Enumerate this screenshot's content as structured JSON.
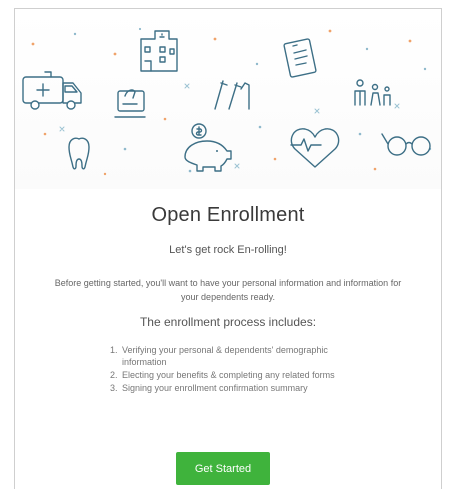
{
  "title": "Open Enrollment",
  "tagline": "Let's get rock En-rolling!",
  "intro": "Before getting started, you'll want to have your personal information and information for your dependents ready.",
  "process_heading": "The enrollment process includes:",
  "steps": [
    {
      "num": "1.",
      "text": "Verifying your personal & dependents' demographic information"
    },
    {
      "num": "2.",
      "text": "Electing your benefits & completing any related forms"
    },
    {
      "num": "3.",
      "text": "Signing your enrollment confirmation summary"
    }
  ],
  "cta_label": "Get Started",
  "colors": {
    "accent": "#3fb33c",
    "icon_stroke": "#3d6f86",
    "dots_orange": "#f0a36a",
    "dots_blue": "#8fb9cc"
  },
  "hero_icons": [
    "ambulance-icon",
    "hospital-building-icon",
    "hand-with-card-icon",
    "medical-form-icon",
    "crutches-icon",
    "family-icon",
    "tooth-icon",
    "piggy-bank-icon",
    "heart-pulse-icon",
    "eyeglasses-icon"
  ]
}
